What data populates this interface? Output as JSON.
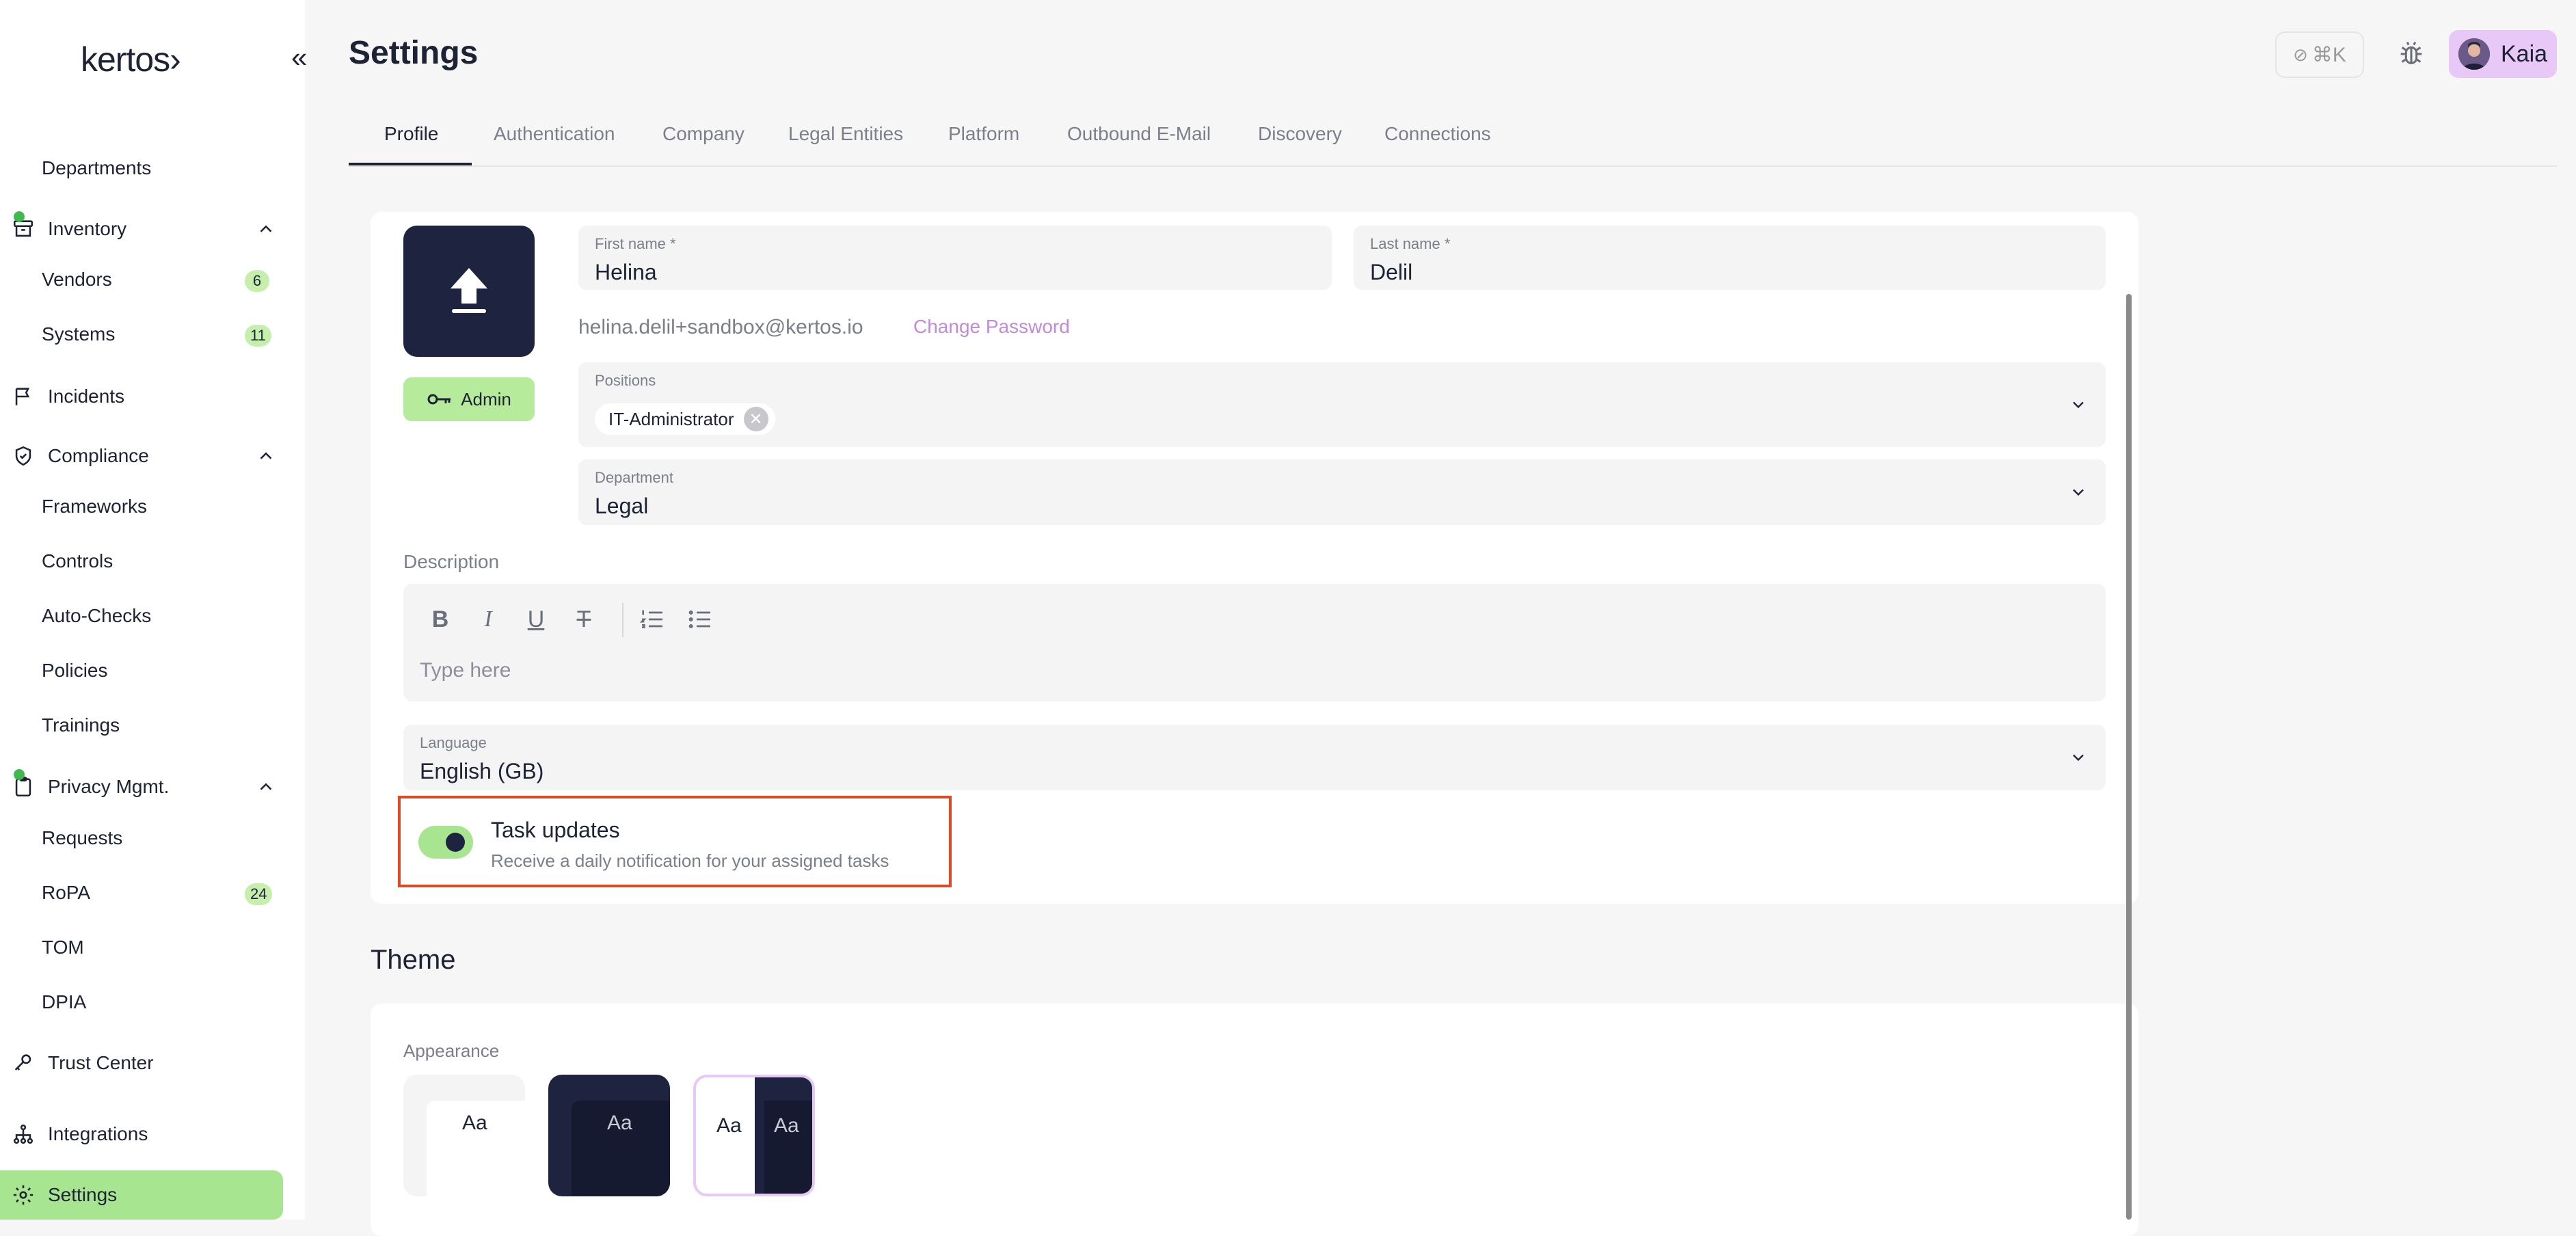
{
  "brand": {
    "logo_text": "kertos›"
  },
  "sidebar": {
    "items": [
      {
        "label": "Departments"
      },
      {
        "label": "Inventory"
      },
      {
        "label": "Vendors",
        "badge": "6"
      },
      {
        "label": "Systems",
        "badge": "11"
      },
      {
        "label": "Incidents"
      },
      {
        "label": "Compliance"
      },
      {
        "label": "Frameworks"
      },
      {
        "label": "Controls"
      },
      {
        "label": "Auto-Checks"
      },
      {
        "label": "Policies"
      },
      {
        "label": "Trainings"
      },
      {
        "label": "Privacy Mgmt."
      },
      {
        "label": "Requests"
      },
      {
        "label": "RoPA",
        "badge": "24"
      },
      {
        "label": "TOM"
      },
      {
        "label": "DPIA"
      },
      {
        "label": "Trust Center"
      },
      {
        "label": "Integrations"
      },
      {
        "label": "Settings"
      }
    ]
  },
  "header": {
    "title": "Settings",
    "shortcut": "⌘K",
    "user_name": "Kaia"
  },
  "tabs": [
    {
      "label": "Profile"
    },
    {
      "label": "Authentication"
    },
    {
      "label": "Company"
    },
    {
      "label": "Legal Entities"
    },
    {
      "label": "Platform"
    },
    {
      "label": "Outbound E-Mail"
    },
    {
      "label": "Discovery"
    },
    {
      "label": "Connections"
    }
  ],
  "profile": {
    "role_badge": "Admin",
    "first_name": {
      "label": "First name *",
      "value": "Helina"
    },
    "last_name": {
      "label": "Last name *",
      "value": "Delil"
    },
    "email": "helina.delil+sandbox@kertos.io",
    "change_password": "Change Password",
    "positions": {
      "label": "Positions",
      "chips": [
        "IT-Administrator"
      ]
    },
    "department": {
      "label": "Department",
      "value": "Legal"
    },
    "description": {
      "label": "Description",
      "placeholder": "Type here"
    },
    "language": {
      "label": "Language",
      "value": "English (GB)"
    },
    "task_updates": {
      "title": "Task updates",
      "description": "Receive a daily notification for your assigned tasks",
      "enabled": true
    }
  },
  "theme": {
    "title": "Theme",
    "appearance_label": "Appearance",
    "options": [
      {
        "sample": "Aa",
        "selected": false
      },
      {
        "sample": "Aa",
        "selected": false
      },
      {
        "sample_left": "Aa",
        "sample_right": "Aa",
        "selected": true
      }
    ]
  },
  "colors": {
    "accent_green": "#a8e590",
    "accent_purple": "#c18bdc",
    "highlight_red": "#e04a23",
    "dark": "#1e2440"
  }
}
